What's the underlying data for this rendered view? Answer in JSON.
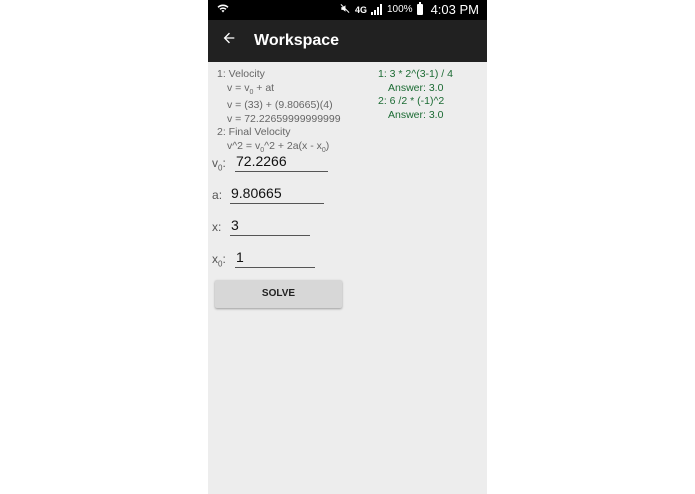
{
  "status_bar": {
    "network": "4G",
    "battery": "100%",
    "time": "4:03 PM"
  },
  "app_bar": {
    "back_icon": "arrow-left-icon",
    "title": "Workspace"
  },
  "steps": {
    "s1_title": "1:  Velocity",
    "s1_line1_a": "v = v",
    "s1_line1_sub": "0",
    "s1_line1_b": " + at",
    "s1_line2": "v = (33) + (9.80665)(4)",
    "s1_line3": "v = 72.22659999999999",
    "s2_title": "2:  Final Velocity",
    "s2_line1_a": "v^2 = v",
    "s2_line1_sub": "0",
    "s2_line1_b": "^2 + 2a(x - x",
    "s2_line1_sub2": "0",
    "s2_line1_c": ")"
  },
  "calculations": [
    {
      "expr": "1:  3 * 2^(3-1) / 4",
      "answer": "Answer: 3.0"
    },
    {
      "expr": "2:  6 /2 * (-1)^2",
      "answer": "Answer: 3.0"
    }
  ],
  "fields": [
    {
      "label": "v",
      "sub": "0",
      "value": "72.2266"
    },
    {
      "label": "a",
      "sub": "",
      "value": "9.80665"
    },
    {
      "label": "x",
      "sub": "",
      "value": "3"
    },
    {
      "label": "x",
      "sub": "0",
      "value": "1"
    }
  ],
  "colon": ":",
  "solve_label": "SOLVE"
}
